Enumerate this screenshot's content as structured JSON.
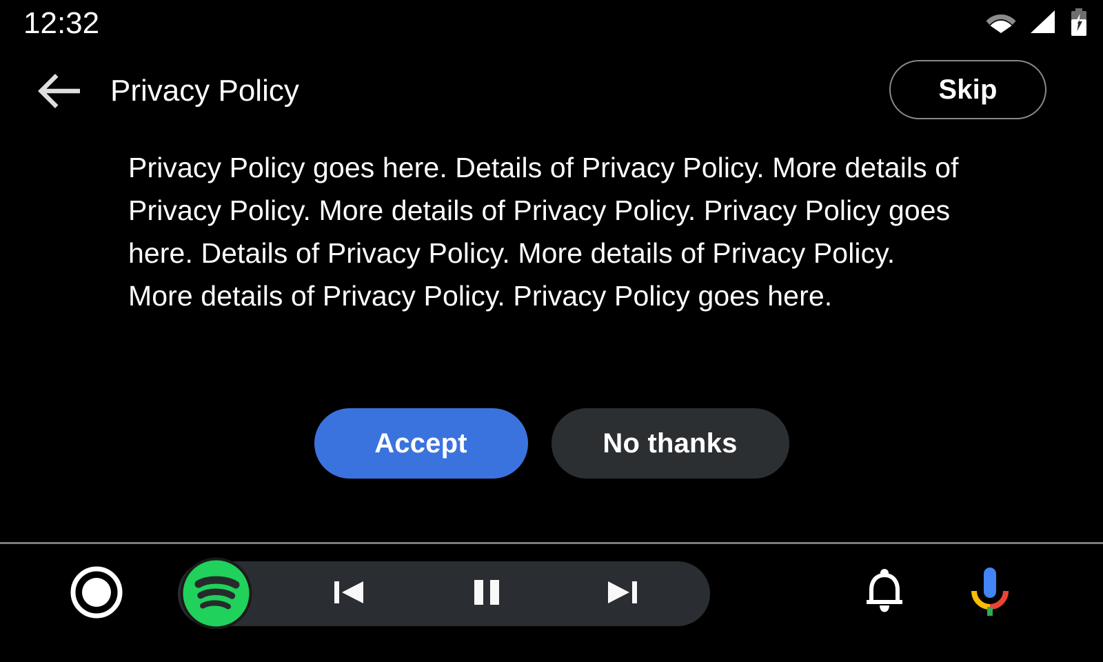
{
  "status_bar": {
    "clock": "12:32",
    "icons": [
      {
        "name": "wifi-icon",
        "label": "Wi-Fi"
      },
      {
        "name": "cellular-signal-icon",
        "label": "Cellular signal"
      },
      {
        "name": "battery-charging-icon",
        "label": "Battery charging"
      }
    ]
  },
  "app_bar": {
    "back_icon": "back-arrow-icon",
    "title": "Privacy Policy",
    "skip_label": "Skip",
    "skip_border_color": "#8a8a8a"
  },
  "content": {
    "policy_text": "Privacy Policy goes here. Details of Privacy Policy. More details of Privacy Policy. More details of Privacy Policy. Privacy Policy goes here. Details of Privacy Policy. More details of Privacy Policy. More details of Privacy Policy. Privacy Policy goes here.",
    "accept_label": "Accept",
    "accept_color": "#3b73de",
    "no_thanks_label": "No thanks",
    "no_thanks_color": "#2c2f32"
  },
  "nav_bar": {
    "home_icon": "home-circle-icon",
    "media": {
      "app_icon": "spotify-icon",
      "app_color": "#20d15c",
      "pill_color": "#2a2d31",
      "previous_icon": "skip-previous-icon",
      "play_pause_icon": "pause-icon",
      "next_icon": "skip-next-icon"
    },
    "notification_icon": "bell-icon",
    "assistant_icon": "google-assistant-mic-icon",
    "assistant_colors": {
      "blue": "#4285f4",
      "red": "#ea4335",
      "yellow": "#fbbc04",
      "green": "#34a853"
    }
  }
}
